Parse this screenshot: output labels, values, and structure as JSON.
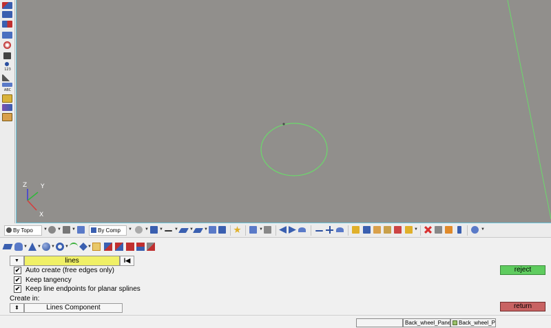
{
  "viewport": {
    "background": "#918f8c",
    "geometry_color": "#6bd96b",
    "axes": {
      "z": "Z",
      "y": "Y",
      "x": "X"
    }
  },
  "left_toolbar": {
    "icons": [
      "top-view-icon",
      "front-view-icon",
      "side-view-icon",
      "iso-view-icon",
      "shaded-view-icon",
      "binoculars-icon",
      "info-icon",
      "measure-icon",
      "angle-icon",
      "label-icon",
      "mask-icon",
      "display-icon",
      "page-icon"
    ],
    "texts": {
      "numbers": "123",
      "abc": "ABC"
    }
  },
  "main_toolbar": {
    "selection_mode": "By Topo",
    "color_mode": "By Comp"
  },
  "panel": {
    "mode_toggle": "▼",
    "entity_selector": "lines",
    "reset_label": "I◀",
    "options": [
      {
        "label": "Auto create (free edges only)",
        "checked": true
      },
      {
        "label": "Keep tangency",
        "checked": true
      },
      {
        "label": "Keep line endpoints for planar splines",
        "checked": true
      }
    ],
    "create_in_label": "Create in:",
    "component_toggle": "⬍",
    "component": "Lines Component",
    "reject_label": "reject",
    "return_label": "return",
    "colors": {
      "reject": "#5fcc5f",
      "return": "#c86363",
      "selector": "#f0f067"
    }
  },
  "status_bar": {
    "fields": [
      "",
      "Back_wheel_Panel",
      "Back_wheel_Panel_"
    ]
  }
}
